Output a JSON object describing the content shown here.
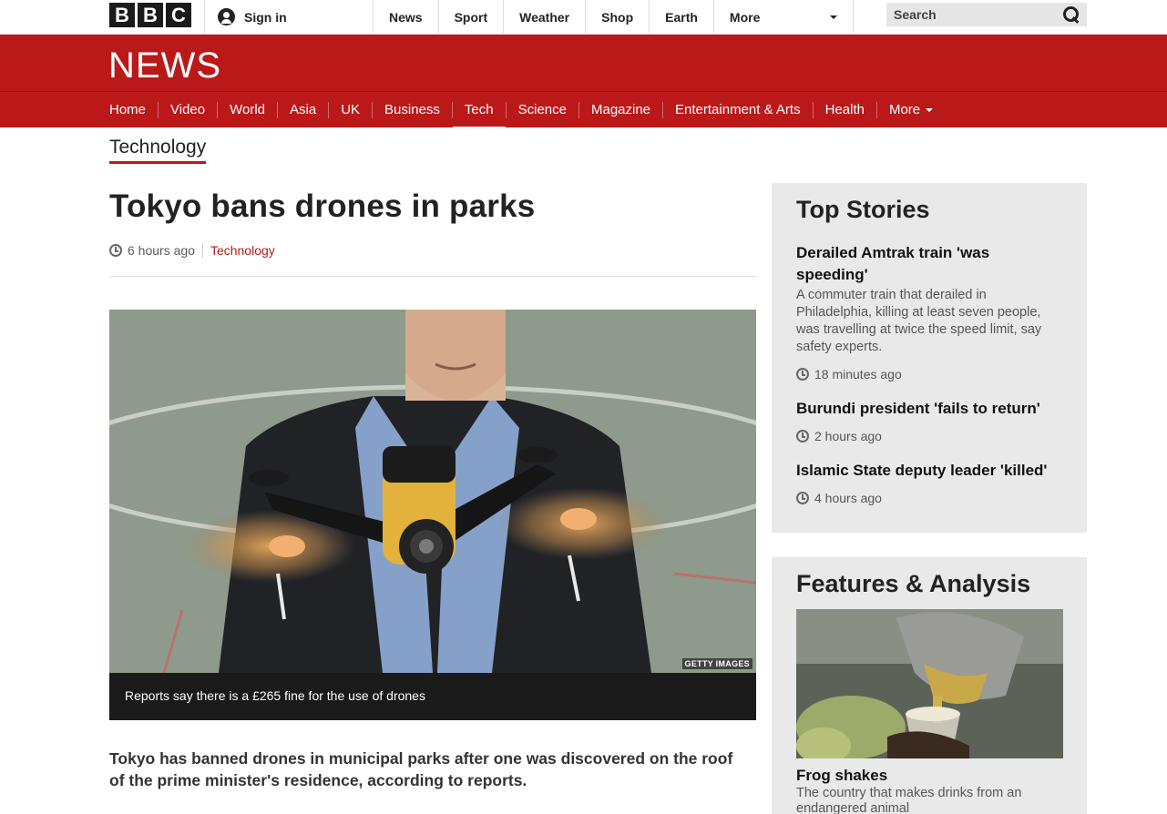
{
  "brand": {
    "letters": [
      "B",
      "B",
      "C"
    ],
    "news_logo": "NEWS"
  },
  "account": {
    "signin_label": "Sign in"
  },
  "global_nav": [
    "News",
    "Sport",
    "Weather",
    "Shop",
    "Earth"
  ],
  "global_nav_more": "More",
  "search": {
    "placeholder": "Search"
  },
  "section_nav": {
    "items": [
      "Home",
      "Video",
      "World",
      "Asia",
      "UK",
      "Business",
      "Tech",
      "Science",
      "Magazine",
      "Entertainment & Arts",
      "Health"
    ],
    "active": "Tech",
    "more_label": "More"
  },
  "section_title": "Technology",
  "article": {
    "headline": "Tokyo bans drones in parks",
    "timestamp": "6 hours ago",
    "category": "Technology",
    "image_credit": "GETTY IMAGES",
    "image_caption": "Reports say there is a £265 fine for the use of drones",
    "intro": "Tokyo has banned drones in municipal parks after one was discovered on the roof of the prime minister's residence, according to reports."
  },
  "top_stories": {
    "heading": "Top Stories",
    "items": [
      {
        "title": "Derailed Amtrak train 'was speeding'",
        "summary": "A commuter train that derailed in Philadelphia, killing at least seven people, was travelling at twice the speed limit, say safety experts.",
        "time": "18 minutes ago"
      },
      {
        "title": "Burundi president 'fails to return'",
        "summary": "",
        "time": "2 hours ago"
      },
      {
        "title": "Islamic State deputy leader 'killed'",
        "summary": "",
        "time": "4 hours ago"
      }
    ]
  },
  "features": {
    "heading": "Features & Analysis",
    "title": "Frog shakes",
    "summary": "The country that makes drinks from an endangered animal"
  },
  "colors": {
    "brand_red": "#bb1919",
    "sidebar_bg": "#e9e9e9",
    "caption_bg": "#1a1a1a"
  }
}
